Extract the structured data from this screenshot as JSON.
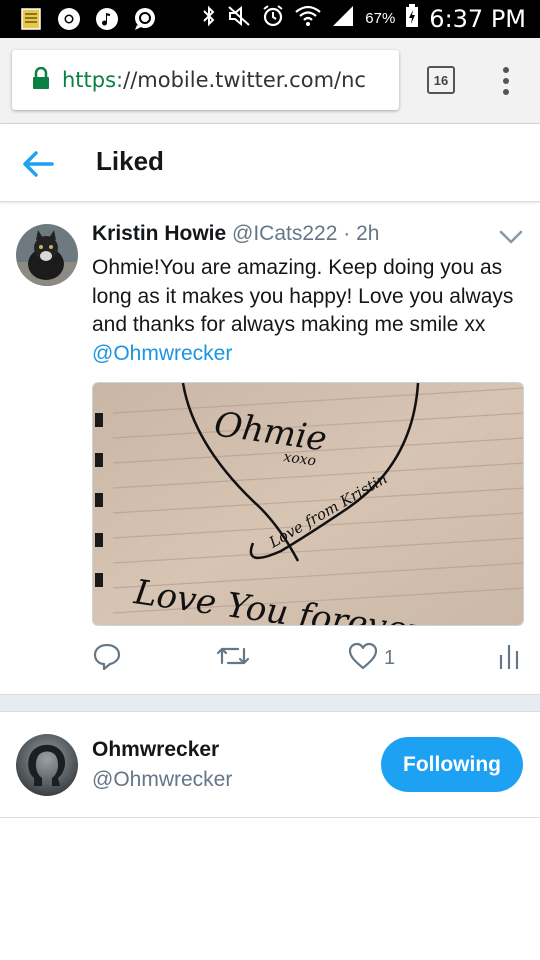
{
  "status_bar": {
    "time": "6:37 PM",
    "battery_percent": "67%",
    "icons": [
      "notes-icon",
      "chrome-icon",
      "music-icon",
      "chat-icon",
      "bluetooth-icon",
      "mute-icon",
      "alarm-icon",
      "wifi-icon",
      "signal-icon",
      "battery-icon"
    ]
  },
  "browser": {
    "url_scheme": "https:",
    "url_rest": "//mobile.twitter.com/nc",
    "tab_count": "16"
  },
  "header": {
    "title": "Liked"
  },
  "tweet": {
    "author_name": "Kristin Howie",
    "author_handle": "@ICats222",
    "dot": "·",
    "time": "2h",
    "text": "Ohmie!You are amazing. Keep doing you as long as it makes you happy! Love you always and thanks for always making me smile xx ",
    "mention": "@Ohmwrecker",
    "media": {
      "line1": "Ohmie",
      "line2": "xoxo",
      "line3": "Love from Kristin",
      "line4": "Love You forever"
    },
    "like_count": "1"
  },
  "user": {
    "name": "Ohmwrecker",
    "handle": "@Ohmwrecker",
    "follow_label": "Following"
  },
  "colors": {
    "accent": "#1da1f2",
    "link": "#1b95e0",
    "secure": "#0b8043"
  }
}
